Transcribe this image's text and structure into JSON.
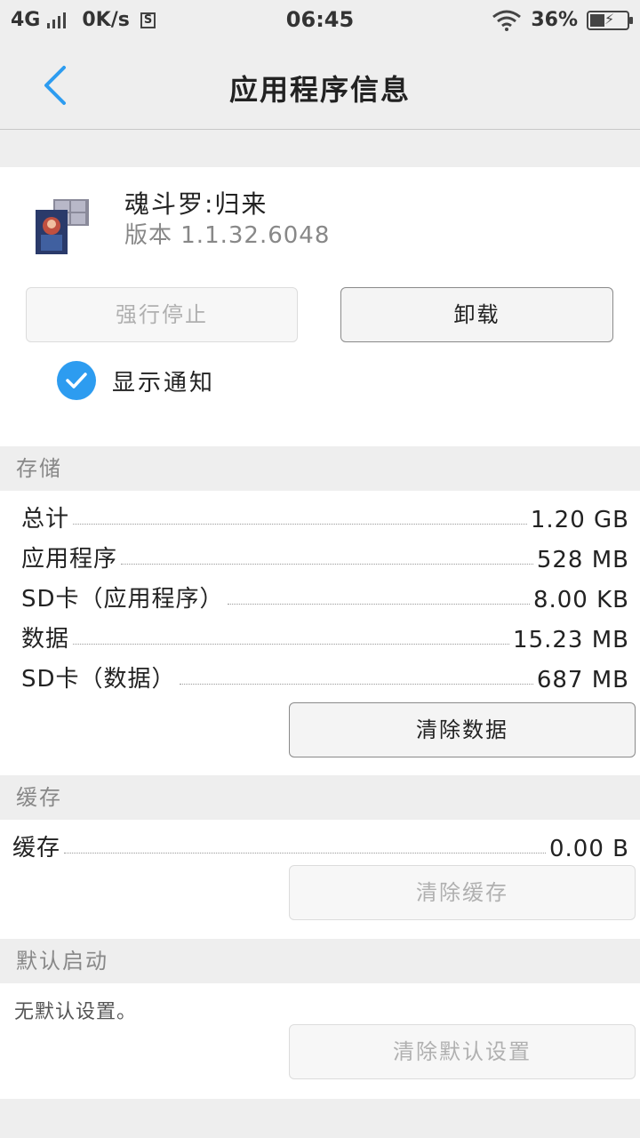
{
  "status_bar": {
    "network": "4G",
    "speed": "0K/s",
    "time": "06:45",
    "battery": "36%"
  },
  "header": {
    "title": "应用程序信息"
  },
  "app": {
    "name": "魂斗罗:归来",
    "version": "版本 1.1.32.6048"
  },
  "buttons": {
    "force_stop": "强行停止",
    "uninstall": "卸载",
    "clear_data": "清除数据",
    "clear_cache": "清除缓存",
    "clear_defaults": "清除默认设置"
  },
  "notification": {
    "label": "显示通知",
    "checked": true
  },
  "storage": {
    "header": "存储",
    "rows": [
      {
        "label": "总计",
        "value": "1.20 GB"
      },
      {
        "label": "应用程序",
        "value": "528 MB"
      },
      {
        "label": "SD卡（应用程序）",
        "value": "8.00 KB"
      },
      {
        "label": "数据",
        "value": "15.23 MB"
      },
      {
        "label": "SD卡（数据）",
        "value": "687 MB"
      }
    ]
  },
  "cache": {
    "header": "缓存",
    "label": "缓存",
    "value": "0.00 B"
  },
  "default_launch": {
    "header": "默认启动",
    "text": "无默认设置。"
  },
  "colors": {
    "accent": "#2d9cf0",
    "background": "#eeeeee"
  }
}
